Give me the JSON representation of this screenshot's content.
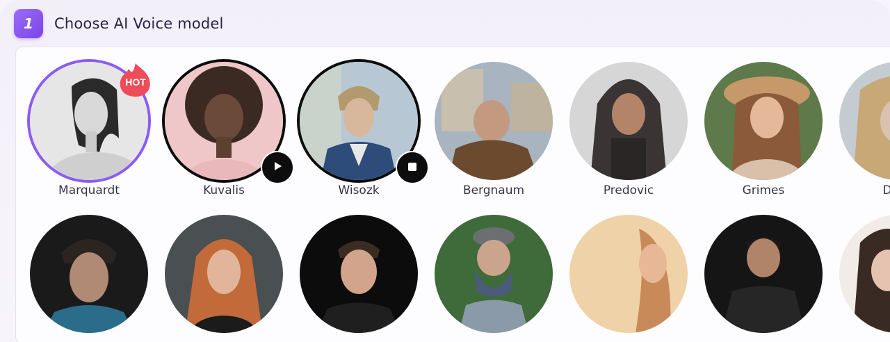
{
  "step": {
    "number": "1",
    "title": "Choose AI Voice model"
  },
  "colors": {
    "accent": "#8c5cf2",
    "hot": "#ef4c59"
  },
  "badges": {
    "hot": "HOT"
  },
  "voices_row1": [
    {
      "name": "Marquardt",
      "state": "selected",
      "badge": "hot"
    },
    {
      "name": "Kuvalis",
      "state": "play"
    },
    {
      "name": "Wisozk",
      "state": "stop"
    },
    {
      "name": "Bergnaum"
    },
    {
      "name": "Predovic"
    },
    {
      "name": "Grimes"
    },
    {
      "name": "Daug"
    }
  ],
  "voices_row2_count": 7,
  "icons": {
    "play": "play-icon",
    "stop": "stop-icon"
  }
}
